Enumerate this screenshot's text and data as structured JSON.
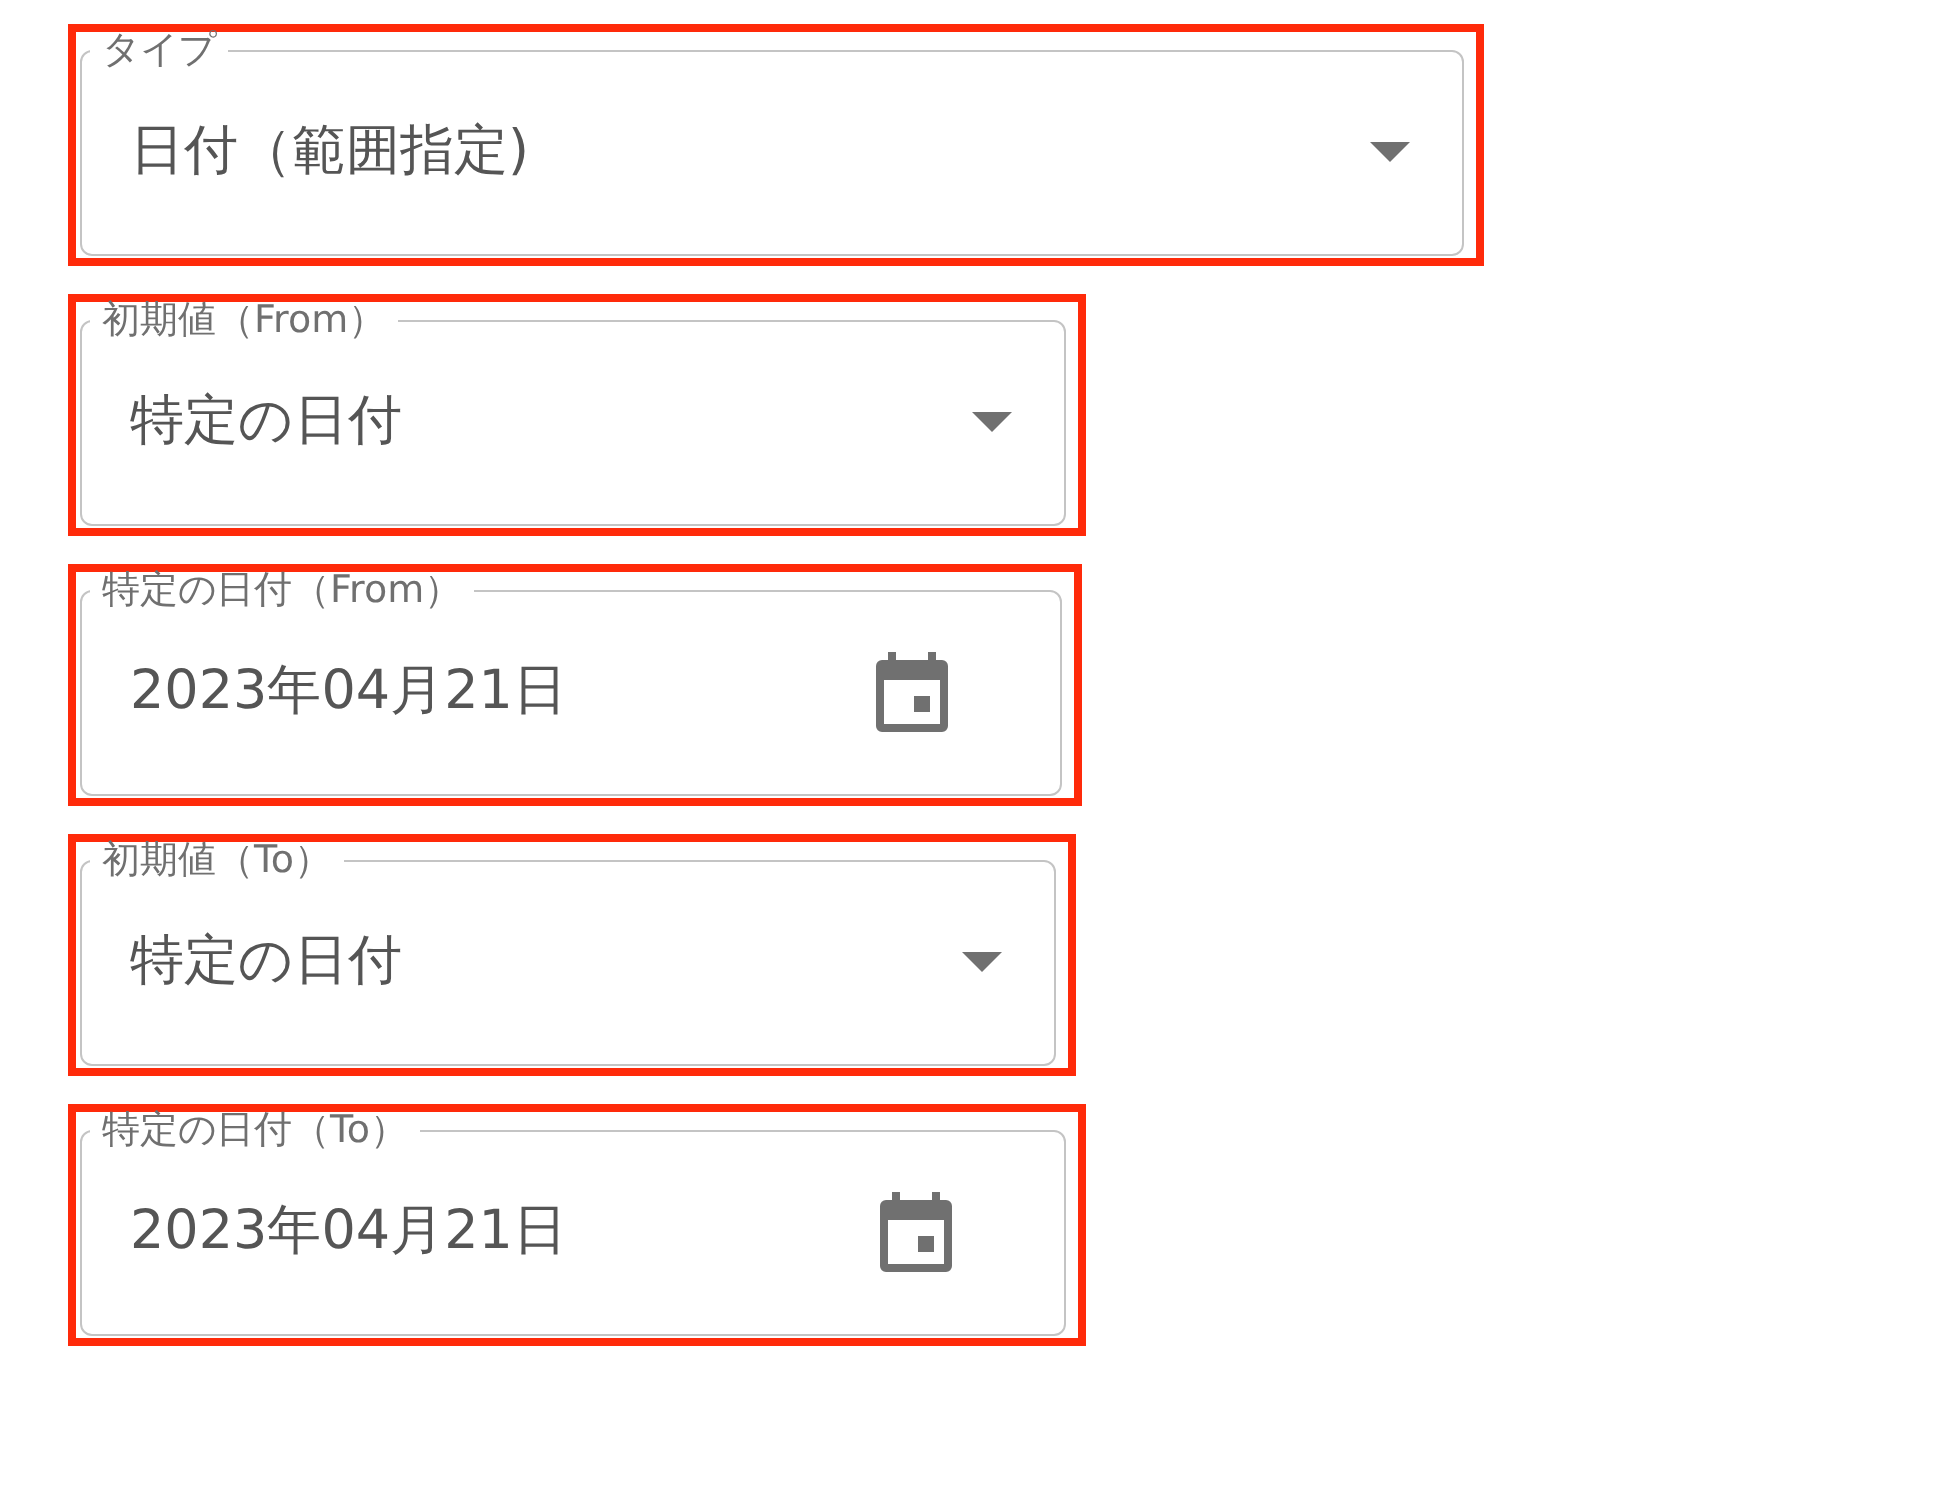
{
  "fields": [
    {
      "kind": "select",
      "label": "タイプ",
      "value": "日付（範囲指定)",
      "highlighted": true
    },
    {
      "kind": "select",
      "label": "初期値（From）",
      "value": "特定の日付",
      "highlighted": true
    },
    {
      "kind": "date",
      "label": "特定の日付（From）",
      "value": "2023年04月21日",
      "highlighted": true
    },
    {
      "kind": "select",
      "label": "初期値（To）",
      "value": "特定の日付",
      "highlighted": true
    },
    {
      "kind": "date",
      "label": "特定の日付（To）",
      "value": "2023年04月21日",
      "highlighted": true
    }
  ]
}
